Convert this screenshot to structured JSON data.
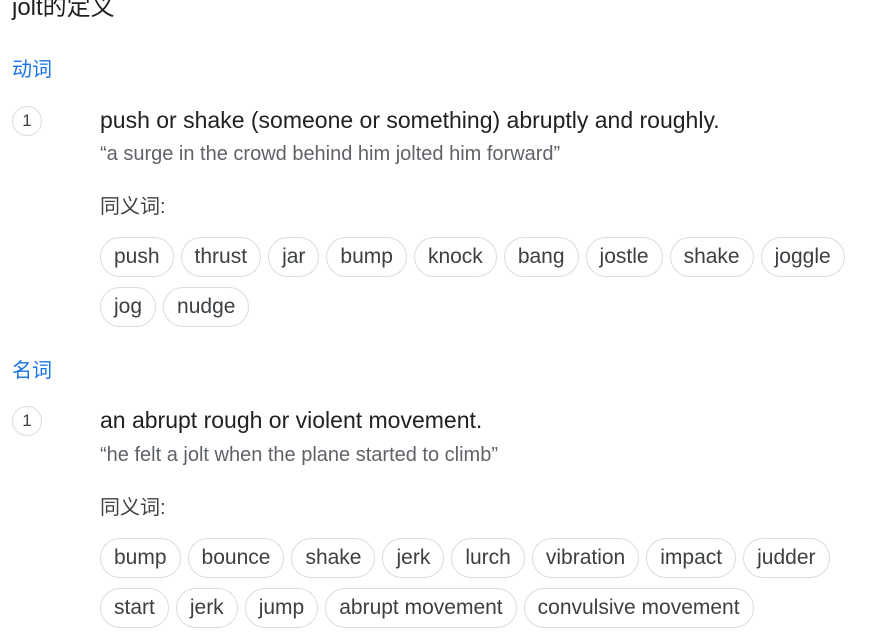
{
  "title": "jolt的定义",
  "verb": {
    "pos_label": "动词",
    "sense_number": "1",
    "definition": "push or shake (someone or something) abruptly and roughly.",
    "example": "“a surge in the crowd behind him jolted him forward”",
    "synonyms_label": "同义词:",
    "synonyms": [
      "push",
      "thrust",
      "jar",
      "bump",
      "knock",
      "bang",
      "jostle",
      "shake",
      "joggle",
      "jog",
      "nudge"
    ]
  },
  "noun": {
    "pos_label": "名词",
    "sense_number": "1",
    "definition": "an abrupt rough or violent movement.",
    "example": "“he felt a jolt when the plane started to climb”",
    "synonyms_label": "同义词:",
    "synonyms": [
      "bump",
      "bounce",
      "shake",
      "jerk",
      "lurch",
      "vibration",
      "impact",
      "judder",
      "start",
      "jerk",
      "jump",
      "abrupt movement",
      "convulsive movement"
    ]
  }
}
